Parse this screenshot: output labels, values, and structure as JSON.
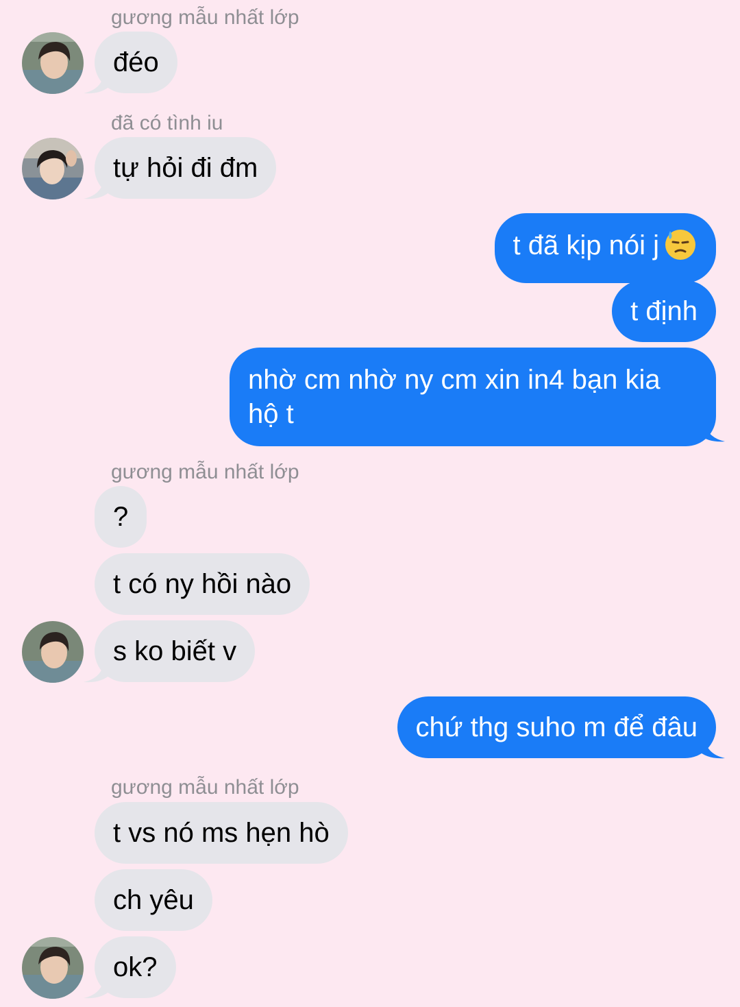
{
  "colors": {
    "background": "#fde8f1",
    "incoming_bubble": "#e5e5ea",
    "outgoing_bubble": "#1a7cf7",
    "sender_name": "#8e8e93"
  },
  "messages": [
    {
      "sender": "gương mẫu nhất lớp",
      "text": "đéo",
      "direction": "incoming"
    },
    {
      "sender": "đã có tình iu",
      "text": "tự hỏi đi đm",
      "direction": "incoming"
    },
    {
      "text": "t đã kịp nói j",
      "emoji": "downcast-face-with-sweat-icon",
      "direction": "outgoing"
    },
    {
      "text": "t định",
      "direction": "outgoing"
    },
    {
      "text": "nhờ cm nhờ ny cm xin in4 bạn kia hộ t",
      "direction": "outgoing"
    },
    {
      "sender": "gương mẫu nhất lớp",
      "text": "?",
      "direction": "incoming"
    },
    {
      "text": "t có ny hồi nào",
      "direction": "incoming"
    },
    {
      "text": "s ko biết v",
      "direction": "incoming"
    },
    {
      "text": "chứ thg suho m để đâu",
      "direction": "outgoing"
    },
    {
      "sender": "gương mẫu nhất lớp",
      "text": "t vs nó ms hẹn hò",
      "direction": "incoming"
    },
    {
      "text": "ch yêu",
      "direction": "incoming"
    },
    {
      "text": "ok?",
      "direction": "incoming"
    }
  ]
}
